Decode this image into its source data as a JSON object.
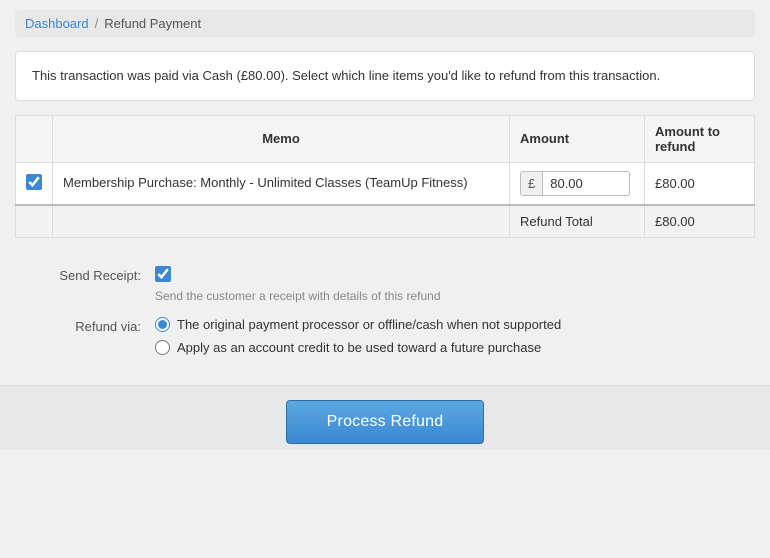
{
  "breadcrumb": {
    "link": "Dashboard",
    "separator": "/",
    "current": "Refund Payment"
  },
  "info_message": "This transaction was paid via Cash (£80.00). Select which line items you'd like to refund from this transaction.",
  "table": {
    "headers": {
      "checkbox": "",
      "memo": "Memo",
      "amount": "Amount",
      "amount_to_refund": "Amount to refund"
    },
    "rows": [
      {
        "checked": true,
        "memo": "Membership Purchase: Monthly - Unlimited Classes (TeamUp Fitness)",
        "currency": "£",
        "amount": "80.00",
        "refund_amount": "£80.00"
      }
    ],
    "total_row": {
      "label": "Refund Total",
      "value": "£80.00"
    }
  },
  "send_receipt": {
    "label": "Send Receipt:",
    "checked": true,
    "hint": "Send the customer a receipt with details of this refund"
  },
  "refund_via": {
    "label": "Refund via:",
    "options": [
      {
        "value": "original",
        "label": "The original payment processor or offline/cash when not supported",
        "checked": true
      },
      {
        "value": "credit",
        "label": "Apply as an account credit to be used toward a future purchase",
        "checked": false
      }
    ]
  },
  "button": {
    "label": "Process Refund"
  }
}
